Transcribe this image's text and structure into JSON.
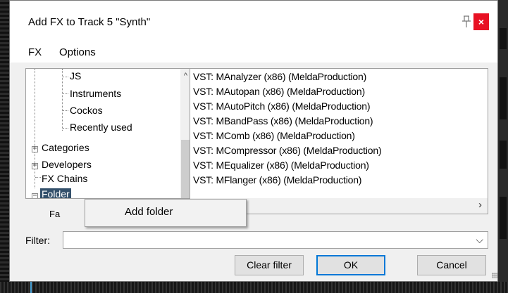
{
  "window": {
    "title": "Add FX to Track 5 \"Synth\"",
    "close_glyph": "×",
    "pin_icon": "pin-icon"
  },
  "menubar": {
    "items": [
      "FX",
      "Options"
    ]
  },
  "tree": {
    "items": [
      {
        "label": "JS"
      },
      {
        "label": "Instruments"
      },
      {
        "label": "Cockos"
      },
      {
        "label": "Recently used"
      },
      {
        "label": "Categories",
        "expander": "+"
      },
      {
        "label": "Developers",
        "expander": "+"
      },
      {
        "label": "FX Chains"
      },
      {
        "label": "Folder",
        "expander": "−",
        "selected": true
      },
      {
        "label": "Fa"
      }
    ],
    "scroll_up_glyph": "^"
  },
  "plugins": [
    "VST: MAnalyzer (x86) (MeldaProduction)",
    "VST: MAutopan (x86) (MeldaProduction)",
    "VST: MAutoPitch (x86) (MeldaProduction)",
    "VST: MBandPass (x86) (MeldaProduction)",
    "VST: MComb (x86) (MeldaProduction)",
    "VST: MCompressor (x86) (MeldaProduction)",
    "VST: MEqualizer (x86) (MeldaProduction)",
    "VST: MFlanger (x86) (MeldaProduction)"
  ],
  "list_scroll_right_glyph": "›",
  "context_menu": {
    "items": [
      "Add folder"
    ]
  },
  "filter": {
    "label": "Filter:",
    "value": "",
    "dropdown_glyph": "⌵"
  },
  "buttons": {
    "clear_filter": "Clear filter",
    "ok": "OK",
    "cancel": "Cancel"
  },
  "colors": {
    "selection": "#33506b",
    "close": "#e81123",
    "focus": "#0078d7"
  }
}
